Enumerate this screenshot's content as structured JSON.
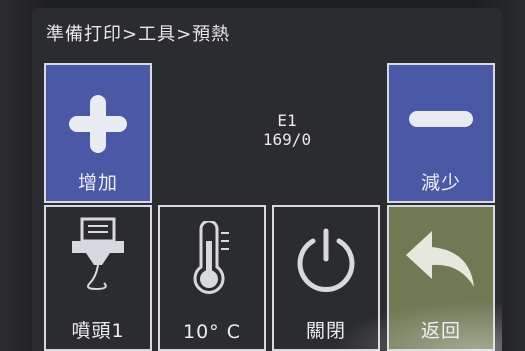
{
  "breadcrumb": "準備打印>工具>預熱",
  "readout": {
    "extruder_label": "E1",
    "temperature_value": "169/0"
  },
  "buttons": {
    "add_label": "增加",
    "subtract_label": "減少",
    "nozzle_label": "噴頭1",
    "step_label": "10° C",
    "close_label": "關閉",
    "back_label": "返回"
  },
  "icons": {
    "add": "plus-icon",
    "subtract": "minus-icon",
    "nozzle": "nozzle-icon",
    "step": "thermometer-icon",
    "close": "power-icon",
    "back": "back-arrow-icon"
  },
  "colors": {
    "screen_bg": "#2b2c30",
    "button_blue": "#4a58a6",
    "button_green": "#6f7a55",
    "text": "#ecedf2"
  }
}
